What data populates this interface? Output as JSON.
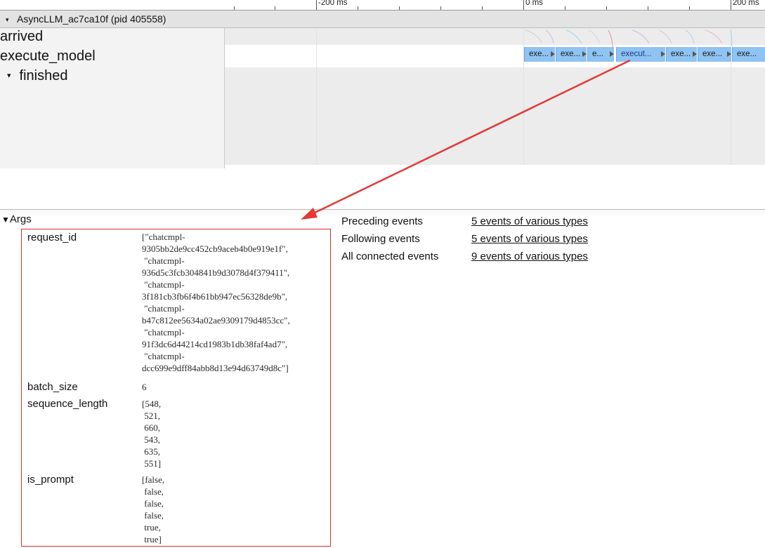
{
  "timeline": {
    "tick_labels": [
      "-200 ms",
      "0 ms",
      "200 ms"
    ]
  },
  "process": {
    "title": "AsyncLLM_ac7ca10f (pid 405558)"
  },
  "tracks": [
    {
      "label": "arrived"
    },
    {
      "label": "execute_model"
    },
    {
      "label": "finished"
    }
  ],
  "slices": [
    "exe...",
    "exe...",
    "e...",
    "execut...",
    "exe...",
    "exe...",
    "exe..."
  ],
  "details": {
    "section_title": "Args",
    "args": [
      {
        "key": "request_id",
        "value": "[\"chatcmpl-\n9305bb2de9cc452cb9aceb4b0e919e1f\",\n \"chatcmpl-\n936d5c3fcb304841b9d3078d4f379411\",\n \"chatcmpl-\n3f181cb3fb6f4b61bb947ec56328de9b\",\n \"chatcmpl-\nb47c812ee5634a02ae9309179d4853cc\",\n \"chatcmpl-\n91f3dc6d44214cd1983b1db38faf4ad7\",\n \"chatcmpl-\ndcc699e9dff84abb8d13e94d63749d8c\"]"
      },
      {
        "key": "batch_size",
        "value": "6"
      },
      {
        "key": "sequence_length",
        "value": "[548,\n 521,\n 660,\n 543,\n 635,\n 551]"
      },
      {
        "key": "is_prompt",
        "value": "[false,\n false,\n false,\n false,\n true,\n true]"
      }
    ],
    "flow_events": [
      {
        "label": "Preceding events",
        "link": "5 events of various types"
      },
      {
        "label": "Following events",
        "link": "5 events of various types"
      },
      {
        "label": "All connected events",
        "link": "9 events of various types"
      }
    ]
  },
  "colors": {
    "slice_fill": "#8ec3f2",
    "annotation": "#d32f2f"
  }
}
